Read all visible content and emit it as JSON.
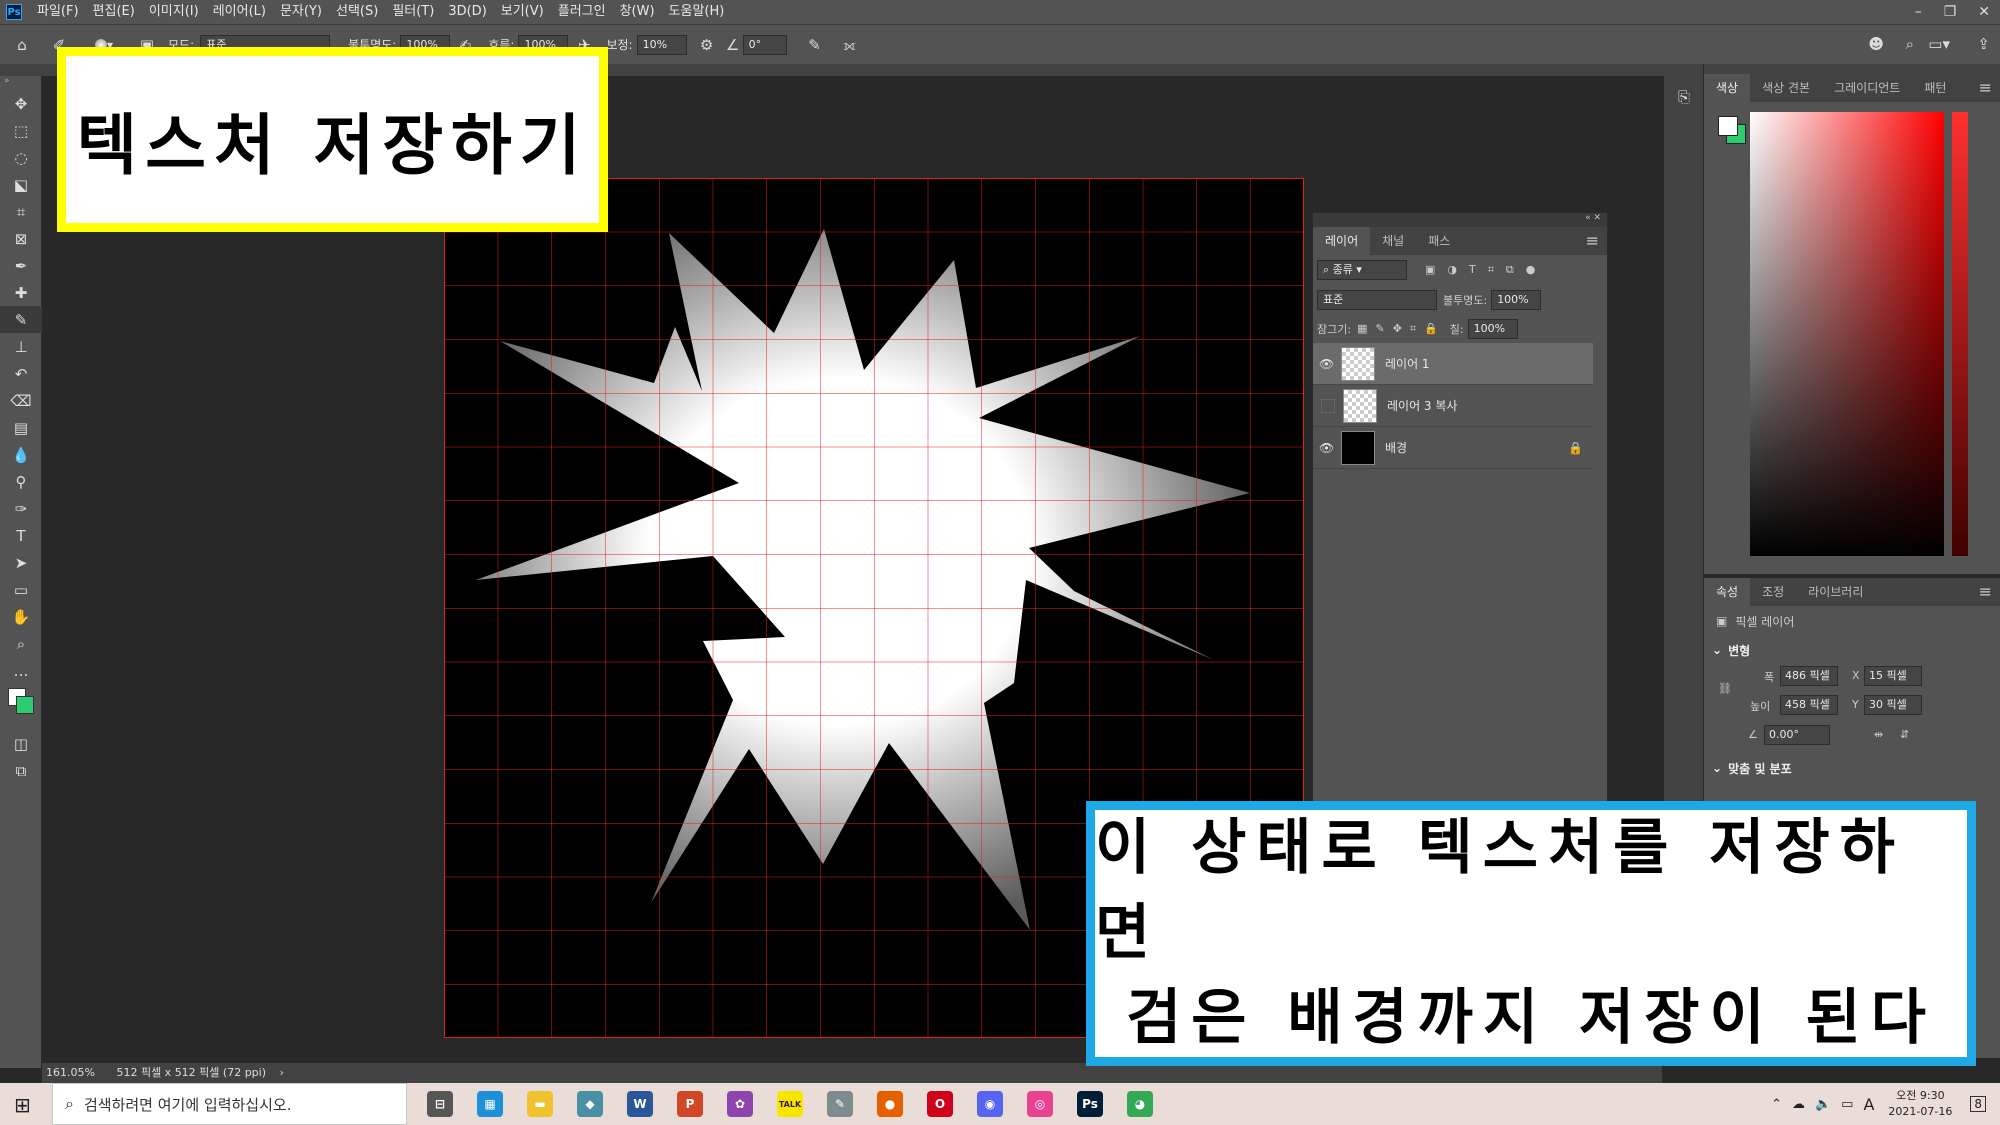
{
  "app": {
    "logo": "Ps"
  },
  "menu": [
    "파일(F)",
    "편집(E)",
    "이미지(I)",
    "레이어(L)",
    "문자(Y)",
    "선택(S)",
    "필터(T)",
    "3D(D)",
    "보기(V)",
    "플러그인",
    "창(W)",
    "도움말(H)"
  ],
  "options": {
    "mode_label": "모드:",
    "mode_value": "표준",
    "opacity_label": "불투명도:",
    "opacity_value": "100%",
    "flow_label": "흐름:",
    "flow_value": "100%",
    "smoothing_label": "보정:",
    "smoothing_value": "10%",
    "angle_value": "0°"
  },
  "tools": [
    "move-icon",
    "marquee-icon",
    "lasso-icon",
    "object-select-icon",
    "crop-icon",
    "frame-icon",
    "eyedropper-icon",
    "healing-icon",
    "brush-icon",
    "stamp-icon",
    "history-brush-icon",
    "eraser-icon",
    "gradient-icon",
    "blur-icon",
    "dodge-icon",
    "pen-icon",
    "type-icon",
    "path-select-icon",
    "rectangle-icon",
    "hand-icon",
    "zoom-icon",
    "more-icon"
  ],
  "status": {
    "zoom": "161.05%",
    "doc_size": "512 픽셀 x 512 픽셀 (72 ppi)"
  },
  "layers_panel": {
    "tabs": [
      "레이어",
      "채널",
      "패스"
    ],
    "filter_label": "종류",
    "blend_mode": "표준",
    "opacity_label": "불투명도:",
    "opacity_value": "100%",
    "lock_label": "잠그기:",
    "fill_label": "칠:",
    "fill_value": "100%",
    "layers": [
      {
        "name": "레이어 1",
        "visible": true,
        "selected": true
      },
      {
        "name": "레이어 3 복사",
        "visible": false,
        "selected": false
      },
      {
        "name": "배경",
        "visible": true,
        "selected": false,
        "locked": true
      }
    ]
  },
  "color_panel": {
    "tabs": [
      "색상",
      "색상 견본",
      "그레이디언트",
      "패턴"
    ],
    "foreground": "#ffffff",
    "background": "#2ecc71",
    "hue": "#ff0000"
  },
  "properties_panel": {
    "tabs": [
      "속성",
      "조정",
      "라이브러리"
    ],
    "kind": "픽셀 레이어",
    "section": "변형",
    "width_label": "폭",
    "width_value": "486 픽셀",
    "x_label": "X",
    "x_value": "15 픽셀",
    "height_label": "높이",
    "height_value": "458 픽셀",
    "y_label": "Y",
    "y_value": "30 픽셀",
    "angle_value": "0.00°",
    "next_section": "맞춤 및 분포"
  },
  "callouts": {
    "title": "텍스처 저장하기",
    "note_line1": "이 상태로 텍스처를 저장하면",
    "note_line2": "검은 배경까지 저장이 된다"
  },
  "taskbar": {
    "search_placeholder": "검색하려면 여기에 입력하십시오.",
    "apps": [
      {
        "name": "task-view",
        "label": "⊟",
        "color": "#555555"
      },
      {
        "name": "app-1",
        "label": "▦",
        "color": "#1e90d6"
      },
      {
        "name": "file-explorer",
        "label": "▬",
        "color": "#f2c12e"
      },
      {
        "name": "app-3",
        "label": "◆",
        "color": "#4a90a4"
      },
      {
        "name": "word",
        "label": "W",
        "color": "#2b579a"
      },
      {
        "name": "powerpoint",
        "label": "P",
        "color": "#d24726"
      },
      {
        "name": "app-6",
        "label": "✿",
        "color": "#8e44ad"
      },
      {
        "name": "kakaotalk",
        "label": "TALK",
        "color": "#f7e600"
      },
      {
        "name": "app-8",
        "label": "✎",
        "color": "#7f8c8d"
      },
      {
        "name": "firefox",
        "label": "●",
        "color": "#e66000"
      },
      {
        "name": "opera",
        "label": "O",
        "color": "#d0021b"
      },
      {
        "name": "discord",
        "label": "◉",
        "color": "#5865f2"
      },
      {
        "name": "app-12",
        "label": "◎",
        "color": "#e84393"
      },
      {
        "name": "photoshop",
        "label": "Ps",
        "color": "#001e36"
      },
      {
        "name": "chrome",
        "label": "◕",
        "color": "#34a853"
      }
    ],
    "ime": "A",
    "time_line1": "오전 9:30",
    "time_line2": "2021-07-16",
    "notifications": "8"
  }
}
